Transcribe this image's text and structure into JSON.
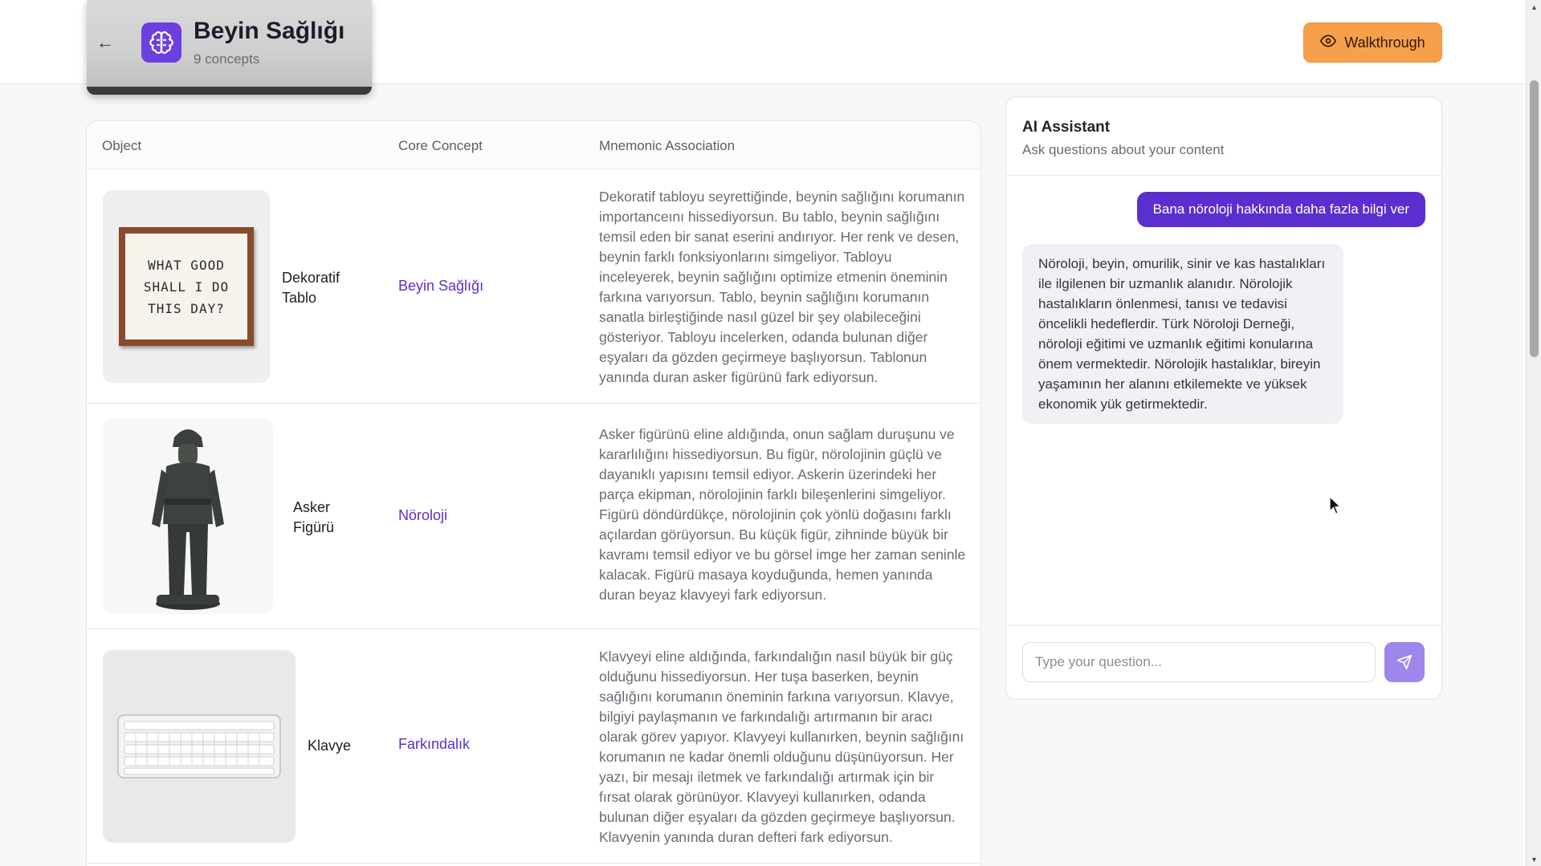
{
  "header": {
    "back_label": "←",
    "title": "Beyin Sağlığı",
    "subtitle": "9 concepts",
    "walkthrough_label": "Walkthrough"
  },
  "table": {
    "columns": [
      "Object",
      "Core Concept",
      "Mnemonic Association"
    ],
    "rows": [
      {
        "object": "Dekoratif Tablo",
        "image_text": "WHAT GOOD SHALL I DO THIS DAY?",
        "concept": "Beyin Sağlığı",
        "mnemonic": "Dekoratif tabloyu seyrettiğinde, beynin sağlığını korumanın importanceını hissediyorsun. Bu tablo, beynin sağlığını temsil eden bir sanat eserini andırıyor. Her renk ve desen, beynin farklı fonksiyonlarını simgeliyor. Tabloyu inceleyerek, beynin sağlığını optimize etmenin öneminin farkına varıyorsun. Tablo, beynin sağlığını korumanın sanatla birleştiğinde nasıl güzel bir şey olabileceğini gösteriyor. Tabloyu incelerken, odanda bulunan diğer eşyaları da gözden geçirmeye başlıyorsun. Tablonun yanında duran asker figürünü fark ediyorsun."
      },
      {
        "object": "Asker Figürü",
        "concept": "Nöroloji",
        "mnemonic": "Asker figürünü eline aldığında, onun sağlam duruşunu ve kararlılığını hissediyorsun. Bu figür, nörolojinin güçlü ve dayanıklı yapısını temsil ediyor. Askerin üzerindeki her parça ekipman, nörolojinin farklı bileşenlerini simgeliyor. Figürü döndürdükçe, nörolojinin çok yönlü doğasını farklı açılardan görüyorsun. Bu küçük figür, zihninde büyük bir kavramı temsil ediyor ve bu görsel imge her zaman seninle kalacak. Figürü masaya koyduğunda, hemen yanında duran beyaz klavyeyi fark ediyorsun."
      },
      {
        "object": "Klavye",
        "concept": "Farkındalık",
        "mnemonic": "Klavyeyi eline aldığında, farkındalığın nasıl büyük bir güç olduğunu hissediyorsun. Her tuşa baserken, beynin sağlığını korumanın öneminin farkına varıyorsun. Klavye, bilgiyi paylaşmanın ve farkındalığı artırmanın bir aracı olarak görev yapıyor. Klavyeyi kullanırken, beynin sağlığını korumanın ne kadar önemli olduğunu düşünüyorsun. Her yazı, bir mesajı iletmek ve farkındalığı artırmak için bir fırsat olarak görünüyor. Klavyeyi kullanırken, odanda bulunan diğer eşyaları da gözden geçirmeye başlıyorsun. Klavyenin yanında duran defteri fark ediyorsun."
      }
    ]
  },
  "chat": {
    "title": "AI Assistant",
    "subtitle": "Ask questions about your content",
    "user_message": "Bana nöroloji hakkında daha fazla bilgi ver",
    "ai_message": "Nöroloji, beyin, omurilik, sinir ve kas hastalıkları ile ilgilenen bir uzmanlık alanıdır. Nörolojik hastalıkların önlenmesi, tanısı ve tedavisi öncelikli hedeflerdir. Türk Nöroloji Derneği, nöroloji eğitimi ve uzmanlık eğitimi konularına önem vermektedir. Nörolojik hastalıklar, bireyin yaşamının her alanını etkilemekte ve yüksek ekonomik yük getirmektedir.",
    "input_placeholder": "Type your question..."
  },
  "colors": {
    "accent": "#5b2fcf",
    "walkthrough": "#f7a04b",
    "send_button": "#9f86ea"
  }
}
